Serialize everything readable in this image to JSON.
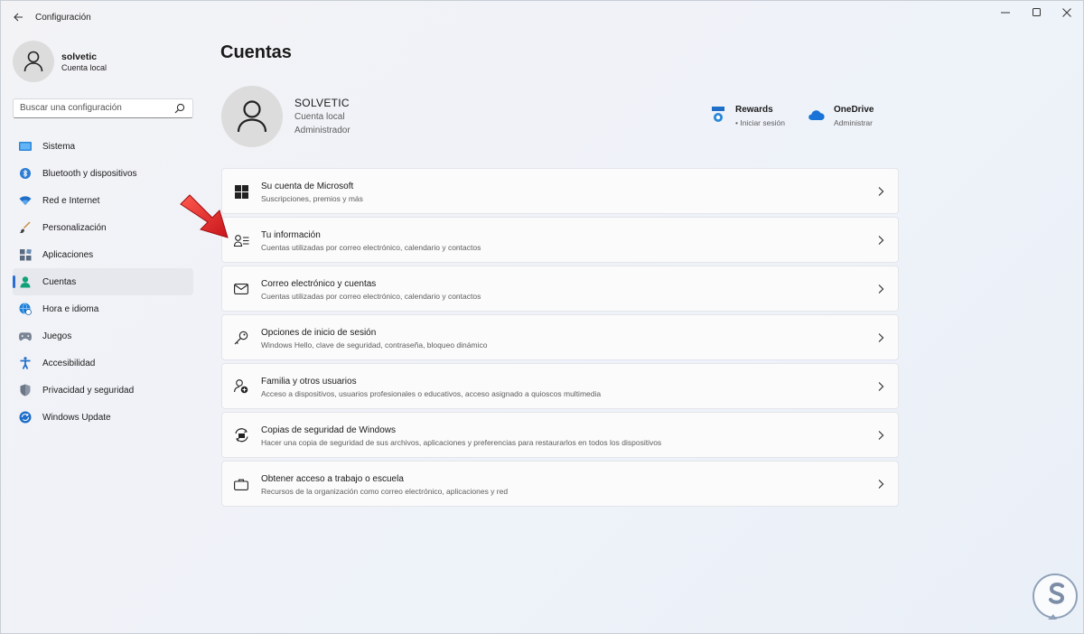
{
  "window": {
    "title": "Configuración"
  },
  "profile": {
    "name": "solvetic",
    "subtitle": "Cuenta local"
  },
  "search": {
    "placeholder": "Buscar una configuración"
  },
  "nav": {
    "items": [
      {
        "label": "Sistema",
        "icon": "system-icon",
        "active": false
      },
      {
        "label": "Bluetooth y dispositivos",
        "icon": "bluetooth-icon",
        "active": false
      },
      {
        "label": "Red e Internet",
        "icon": "wifi-icon",
        "active": false
      },
      {
        "label": "Personalización",
        "icon": "brush-icon",
        "active": false
      },
      {
        "label": "Aplicaciones",
        "icon": "apps-icon",
        "active": false
      },
      {
        "label": "Cuentas",
        "icon": "person-icon",
        "active": true
      },
      {
        "label": "Hora e idioma",
        "icon": "globe-clock-icon",
        "active": false
      },
      {
        "label": "Juegos",
        "icon": "gamepad-icon",
        "active": false
      },
      {
        "label": "Accesibilidad",
        "icon": "accessibility-icon",
        "active": false
      },
      {
        "label": "Privacidad y seguridad",
        "icon": "shield-icon",
        "active": false
      },
      {
        "label": "Windows Update",
        "icon": "update-icon",
        "active": false
      }
    ]
  },
  "main": {
    "title": "Cuentas",
    "account": {
      "name": "SOLVETIC",
      "type": "Cuenta local",
      "role": "Administrador"
    },
    "services": [
      {
        "title": "Rewards",
        "subtitle": "• Iniciar sesión",
        "icon": "rewards-icon"
      },
      {
        "title": "OneDrive",
        "subtitle": "Administrar",
        "icon": "onedrive-icon"
      }
    ],
    "cards": [
      {
        "title": "Su cuenta de Microsoft",
        "subtitle": "Suscripciones, premios y más",
        "icon": "windows-logo-icon"
      },
      {
        "title": "Tu información",
        "subtitle": "Cuentas utilizadas por correo electrónico, calendario y contactos",
        "icon": "contact-card-icon"
      },
      {
        "title": "Correo electrónico y cuentas",
        "subtitle": "Cuentas utilizadas por correo electrónico, calendario y contactos",
        "icon": "mail-icon"
      },
      {
        "title": "Opciones de inicio de sesión",
        "subtitle": "Windows Hello, clave de seguridad, contraseña, bloqueo dinámico",
        "icon": "key-icon"
      },
      {
        "title": "Familia y otros usuarios",
        "subtitle": "Acceso a dispositivos, usuarios profesionales o educativos, acceso asignado a quioscos multimedia",
        "icon": "add-person-icon"
      },
      {
        "title": "Copias de seguridad de Windows",
        "subtitle": "Hacer una copia de seguridad de sus archivos, aplicaciones y preferencias para restaurarlos en todos los dispositivos",
        "icon": "backup-icon"
      },
      {
        "title": "Obtener acceso a trabajo o escuela",
        "subtitle": "Recursos de la organización como correo electrónico, aplicaciones y red",
        "icon": "briefcase-icon"
      }
    ]
  },
  "colors": {
    "accent": "#2c6dd4",
    "annotation_arrow": "#e8262b"
  }
}
